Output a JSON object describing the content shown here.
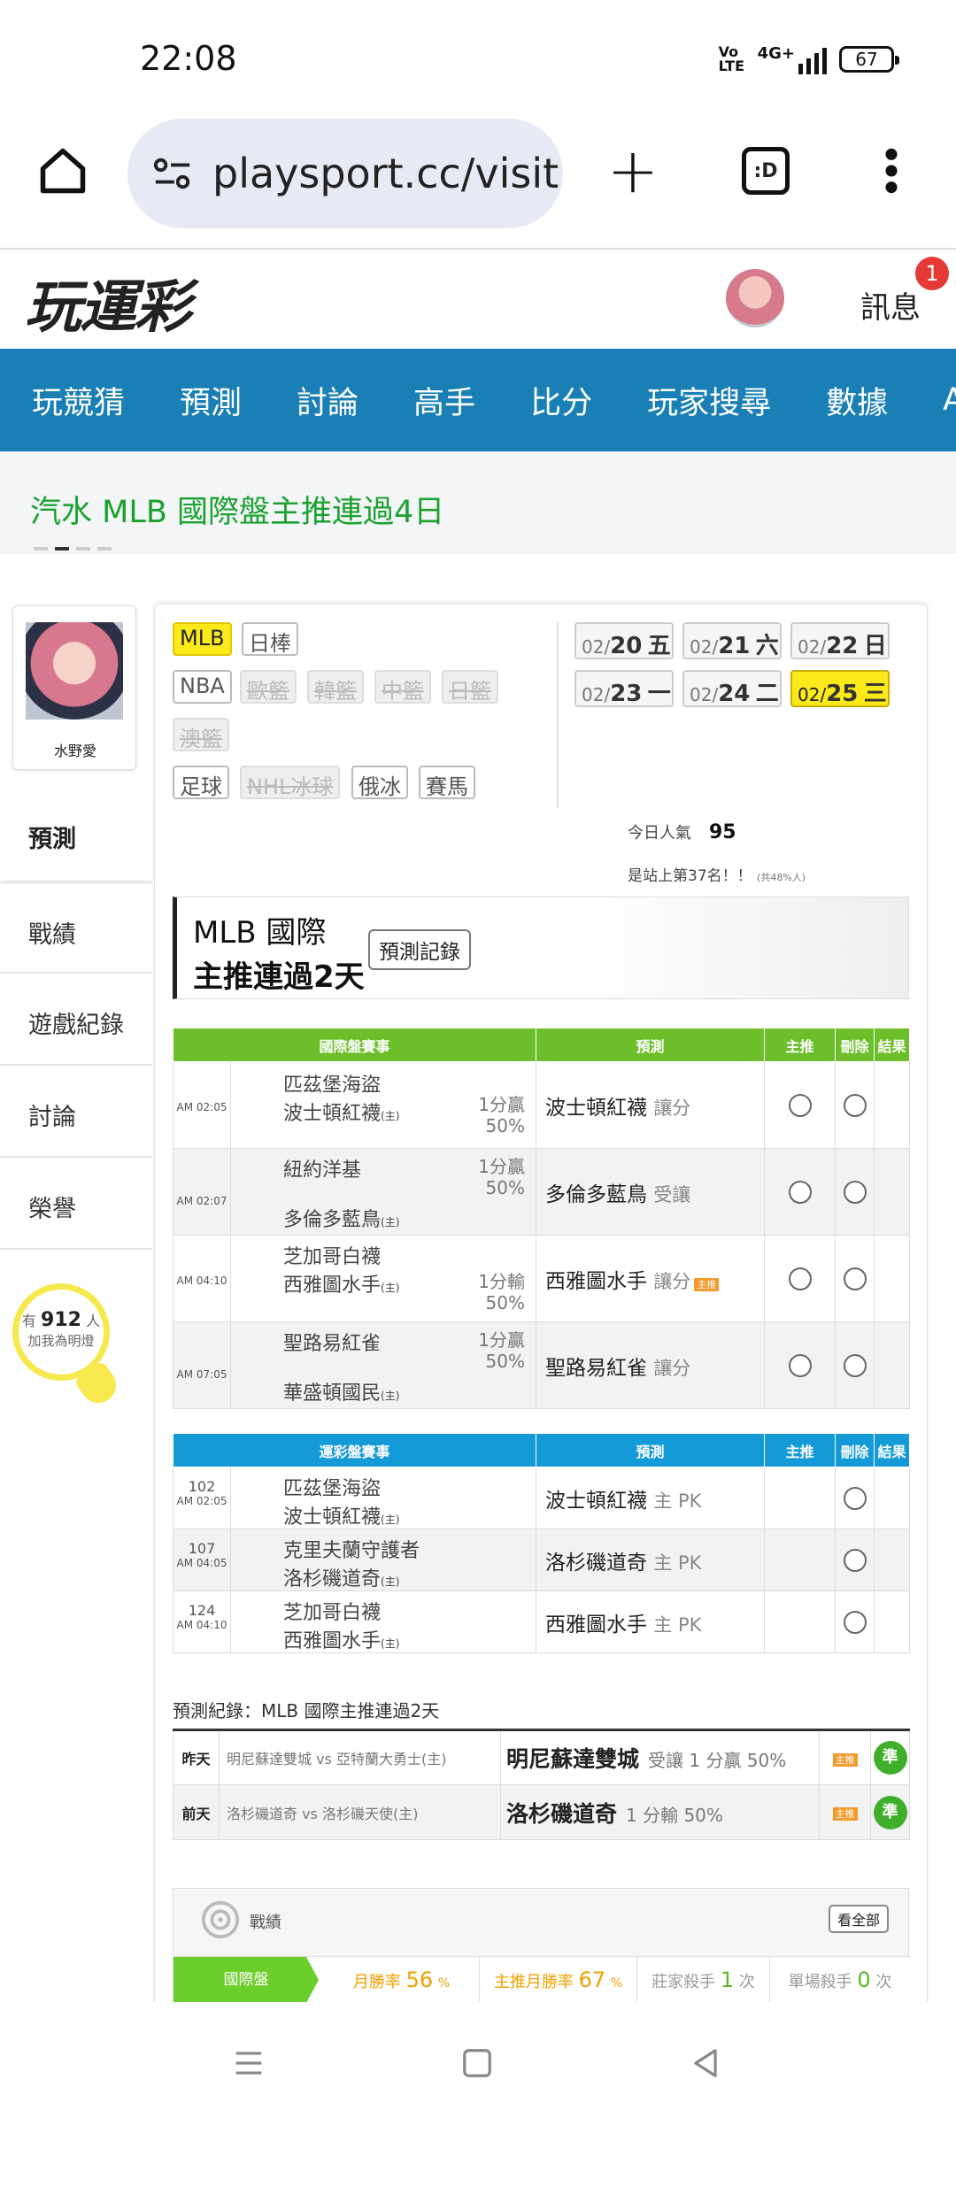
{
  "status_bar": {
    "time": "22:08",
    "volte": "Vo LTE",
    "network": "4G+",
    "battery": "67"
  },
  "browser": {
    "url": "playsport.cc/visit"
  },
  "site_header": {
    "logo": "玩運彩",
    "messages_label": "訊息",
    "messages_badge": "1"
  },
  "nav": {
    "items": [
      "玩競猜",
      "預測",
      "討論",
      "高手",
      "比分",
      "玩家搜尋",
      "數據",
      "APP"
    ]
  },
  "promo": {
    "text": "汽水 MLB 國際盤主推連過4日"
  },
  "sidebar": {
    "profile_name": "水野愛",
    "items": [
      "預測",
      "戰績",
      "遊戲紀錄",
      "討論",
      "榮譽"
    ],
    "followers_prefix": "有",
    "followers_count": "912",
    "followers_suffix": "人",
    "followers_sub": "加我為明燈"
  },
  "league_tags": {
    "row1": [
      "MLB",
      "日棒"
    ],
    "row2": [
      "NBA",
      "歐籃",
      "韓籃",
      "中籃",
      "日籃"
    ],
    "row3": [
      "澳籃"
    ],
    "row4": [
      "足球",
      "NHL冰球",
      "俄冰",
      "賽馬"
    ]
  },
  "dates": [
    {
      "md": "02/",
      "d": "20",
      "w": "五"
    },
    {
      "md": "02/",
      "d": "21",
      "w": "六"
    },
    {
      "md": "02/",
      "d": "22",
      "w": "日"
    },
    {
      "md": "02/",
      "d": "23",
      "w": "一"
    },
    {
      "md": "02/",
      "d": "24",
      "w": "二"
    },
    {
      "md": "02/",
      "d": "25",
      "w": "三"
    }
  ],
  "popularity": {
    "label": "今日人氣",
    "value": "95",
    "rank": "是站上第37名！！",
    "rank_note": "(共48%人)"
  },
  "streak": {
    "line1": "MLB 國際",
    "line2": "主推連過2天",
    "button": "預測記錄"
  },
  "intl_table": {
    "headers": [
      "國際盤賽事",
      "預測",
      "主推",
      "刪除",
      "結果"
    ],
    "rows": [
      {
        "time": "AM 02:05",
        "away": "匹茲堡海盜",
        "home": "波士頓紅襪",
        "home_tag": "(主)",
        "odds1": "1分贏",
        "odds2": "50%",
        "pick": "波士頓紅襪",
        "pick_type": "讓分"
      },
      {
        "time": "AM 02:07",
        "away": "紐約洋基",
        "home": "多倫多藍鳥",
        "home_tag": "(主)",
        "odds1": "1分贏",
        "odds2": "50%",
        "pick": "多倫多藍鳥",
        "pick_type": "受讓"
      },
      {
        "time": "AM 04:10",
        "away": "芝加哥白襪",
        "home": "西雅圖水手",
        "home_tag": "(主)",
        "odds1": "1分輸",
        "odds2": "50%",
        "pick": "西雅圖水手",
        "pick_type": "讓分",
        "pick_chip": "主推"
      },
      {
        "time": "AM 07:05",
        "away": "聖路易紅雀",
        "home": "華盛頓國民",
        "home_tag": "(主)",
        "odds1": "1分贏",
        "odds2": "50%",
        "pick": "聖路易紅雀",
        "pick_type": "讓分"
      }
    ]
  },
  "lottery_table": {
    "headers": [
      "運彩盤賽事",
      "預測",
      "主推",
      "刪除",
      "結果"
    ],
    "rows": [
      {
        "num": "102",
        "time": "AM 02:05",
        "away": "匹茲堡海盜",
        "home": "波士頓紅襪",
        "home_tag": "(主)",
        "pick": "波士頓紅襪",
        "pick_type": "主 PK"
      },
      {
        "num": "107",
        "time": "AM 04:05",
        "away": "克里夫蘭守護者",
        "home": "洛杉磯道奇",
        "home_tag": "(主)",
        "pick": "洛杉磯道奇",
        "pick_type": "主 PK"
      },
      {
        "num": "124",
        "time": "AM 04:10",
        "away": "芝加哥白襪",
        "home": "西雅圖水手",
        "home_tag": "(主)",
        "pick": "西雅圖水手",
        "pick_type": "主 PK"
      }
    ]
  },
  "records": {
    "title": "預測紀錄：MLB 國際主推連過2天",
    "rows": [
      {
        "day": "昨天",
        "match": "明尼蘇達雙城 vs 亞特蘭大勇士(主)",
        "pick": "明尼蘇達雙城",
        "detail": "受讓 1 分贏 50%",
        "chip": "主推",
        "result": "準"
      },
      {
        "day": "前天",
        "match": "洛杉磯道奇 vs 洛杉磯天使(主)",
        "pick": "洛杉磯道奇",
        "detail": "1 分輸 50%",
        "chip": "主推",
        "result": "準"
      }
    ]
  },
  "stats": {
    "title": "戰績",
    "view_all": "看全部",
    "row_label": "國際盤",
    "cells": [
      {
        "label": "月勝率",
        "value": "56",
        "unit": "%"
      },
      {
        "label": "主推月勝率",
        "value": "67",
        "unit": "%"
      },
      {
        "label": "莊家殺手",
        "value": "1",
        "unit": "次"
      },
      {
        "label": "單場殺手",
        "value": "0",
        "unit": "次"
      }
    ]
  },
  "colors": {
    "nav_blue": "#1a7fb5",
    "green": "#6cbf2a",
    "blue_header": "#159ad8",
    "yellow": "#fce91a",
    "promo_green": "#1aa12f"
  }
}
